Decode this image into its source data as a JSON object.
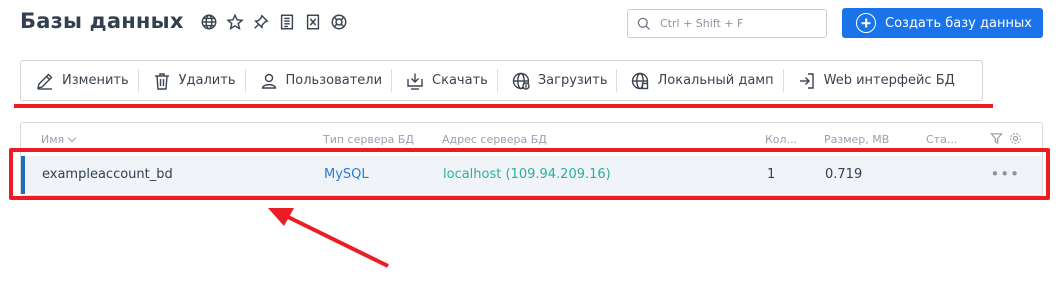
{
  "header": {
    "title": "Базы данных",
    "icons": [
      "globe-icon",
      "star-icon",
      "pin-icon",
      "document-icon",
      "excel-icon",
      "lifebuoy-icon"
    ]
  },
  "search": {
    "placeholder": "Ctrl + Shift + F",
    "icon": "search-icon"
  },
  "create_button": {
    "label": "Создать базу данных",
    "icon": "plus-circle-icon",
    "color": "#1a73e8"
  },
  "toolbar": {
    "items": [
      {
        "label": "Изменить",
        "icon": "pencil-icon"
      },
      {
        "label": "Удалить",
        "icon": "trash-icon"
      },
      {
        "label": "Пользователи",
        "icon": "user-icon"
      },
      {
        "label": "Скачать",
        "icon": "download-icon"
      },
      {
        "label": "Загрузить",
        "icon": "globe-upload-icon"
      },
      {
        "label": "Локальный дамп",
        "icon": "globe-dump-icon"
      },
      {
        "label": "Web интерфейс БД",
        "icon": "login-icon"
      }
    ]
  },
  "table": {
    "columns": [
      "Имя",
      "Тип сервера БД",
      "Адрес сервера БД",
      "Кол...",
      "Размер, MB",
      "Ста..."
    ],
    "rows": [
      {
        "name": "exampleaccount_bd",
        "type": "MySQL",
        "address": "localhost (109.94.209.16)",
        "connections": "1",
        "size": "0.719",
        "status": ""
      }
    ],
    "selected_accent": "#1f6db8"
  },
  "annotations": {
    "color": "#ec1c24"
  }
}
